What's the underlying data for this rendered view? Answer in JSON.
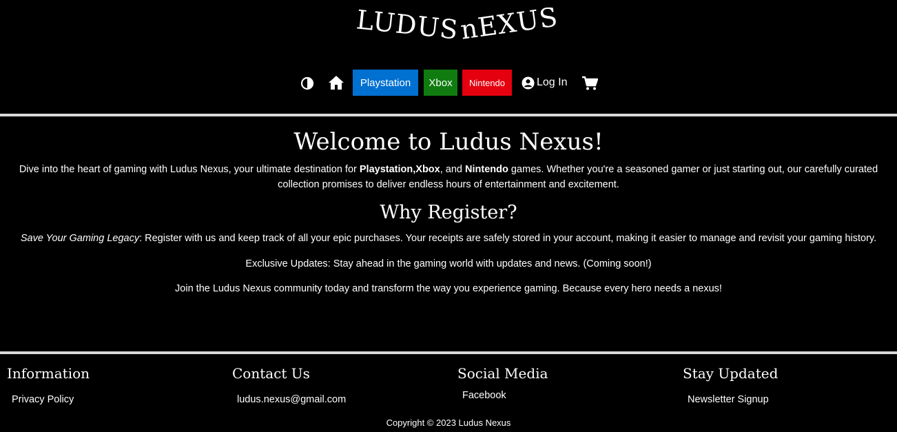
{
  "header": {
    "logo_word1": "LUDUS",
    "logo_word2": "nEXUS"
  },
  "nav": {
    "contrast_icon": "contrast-icon",
    "home_icon": "home-icon",
    "playstation_label": "Playstation",
    "xbox_label": "Xbox",
    "nintendo_label": "Nintendo",
    "login_label": "Log In",
    "cart_icon": "cart-icon",
    "colors": {
      "playstation": "#0070d1",
      "xbox": "#107c10",
      "nintendo": "#e4000f"
    }
  },
  "main": {
    "title": "Welcome to Ludus Nexus!",
    "intro_before": "Dive into the heart of gaming with Ludus Nexus, your ultimate destination for ",
    "intro_ps": "Playstation",
    "intro_comma": ",",
    "intro_xbox": "Xbox",
    "intro_and": ", and ",
    "intro_nintendo": "Nintendo",
    "intro_after": " games. Whether you're a seasoned gamer or just starting out, our carefully curated collection promises to deliver endless hours of entertainment and excitement.",
    "subtitle": "Why Register?",
    "p1_italic": "Save Your Gaming Legacy",
    "p1_rest": ": Register with us and keep track of all your epic purchases. Your receipts are safely stored in your account, making it easier to manage and revisit your gaming history.",
    "p2": "Exclusive Updates: Stay ahead in the gaming world with updates and news. (Coming soon!)",
    "p3": "Join the Ludus Nexus community today and transform the way you experience gaming. Because every hero needs a nexus!"
  },
  "footer": {
    "information_heading": "Information",
    "privacy_link": "Privacy Policy",
    "contact_heading": "Contact Us",
    "email_link": "ludus.nexus@gmail.com",
    "social_heading": "Social Media",
    "facebook_link": "Facebook",
    "updated_heading": "Stay Updated",
    "newsletter_link": "Newsletter Signup",
    "copyright": "Copyright © 2023 Ludus Nexus"
  }
}
